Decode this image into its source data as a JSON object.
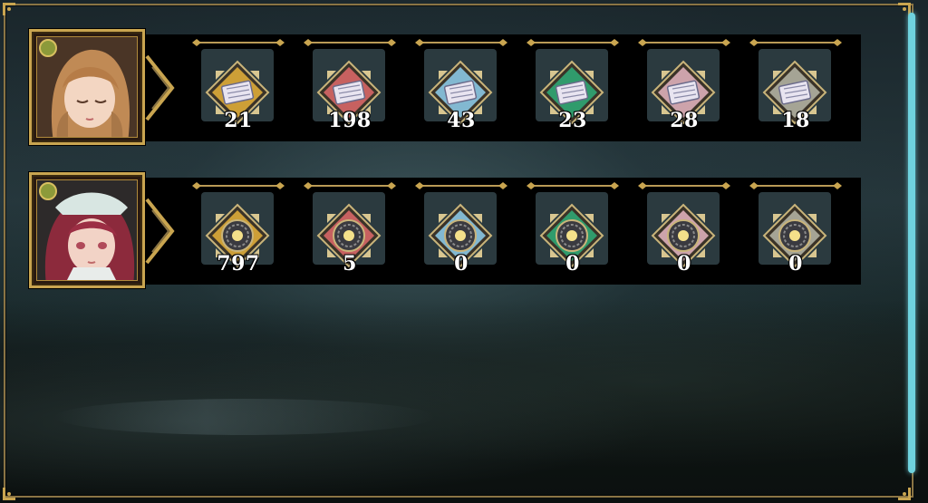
{
  "colors": {
    "frame_gold": "#8a7444",
    "scrollbar": "#6fd2de",
    "panel_bg": "#000000",
    "tile_bg": "#2b3a3f"
  },
  "rows": [
    {
      "character": "brown-haired-girl-portrait",
      "item_kind": "tome",
      "items": [
        {
          "rarity": "gold",
          "accent": "#e8b33a",
          "count": "21"
        },
        {
          "rarity": "red",
          "accent": "#e06a6a",
          "count": "198"
        },
        {
          "rarity": "blue",
          "accent": "#8fd0ee",
          "count": "43"
        },
        {
          "rarity": "green",
          "accent": "#2fae78",
          "count": "23"
        },
        {
          "rarity": "pink",
          "accent": "#e8b7c2",
          "count": "28"
        },
        {
          "rarity": "silver",
          "accent": "#b9b9a8",
          "count": "18"
        }
      ]
    },
    {
      "character": "red-haired-girl-portrait",
      "item_kind": "orb",
      "items": [
        {
          "rarity": "gold",
          "accent": "#e8b33a",
          "count": "797"
        },
        {
          "rarity": "red",
          "accent": "#e06a6a",
          "count": "5"
        },
        {
          "rarity": "blue",
          "accent": "#8fd0ee",
          "count": "0"
        },
        {
          "rarity": "green",
          "accent": "#2fae78",
          "count": "0"
        },
        {
          "rarity": "pink",
          "accent": "#e8b7c2",
          "count": "0"
        },
        {
          "rarity": "silver",
          "accent": "#b9b9a8",
          "count": "0"
        }
      ]
    }
  ]
}
